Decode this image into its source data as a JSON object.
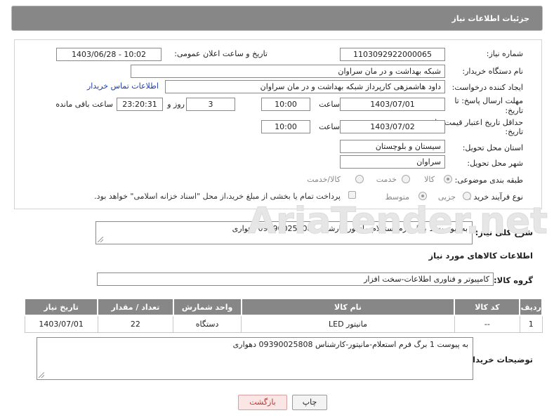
{
  "header": {
    "title": "جزئیات اطلاعات نیاز"
  },
  "form": {
    "need_number_label": "شماره نیاز:",
    "need_number": "1103092922000065",
    "announce_label": "تاریخ و ساعت اعلان عمومی:",
    "announce_value": "1403/06/28 - 10:02",
    "buyer_org_label": "نام دستگاه خریدار:",
    "buyer_org": "شبکه بهداشت و در مان سراوان",
    "creator_label": "ایجاد کننده درخواست:",
    "creator": "داود هاشمزهی  کارپرداز شبکه بهداشت و در مان سراوان",
    "contact_link": "اطلاعات تماس خریدار",
    "reply_deadline_label_1": "مهلت ارسال پاسخ: تا",
    "reply_deadline_label_2": "تاریخ:",
    "reply_date": "1403/07/01",
    "time_label": "ساعت",
    "reply_time": "10:00",
    "days_value": "3",
    "days_label": "روز و",
    "remaining_time": "23:20:31",
    "remaining_label": "ساعت باقی مانده",
    "price_validity_label_1": "حداقل تاریخ اعتبار قیمت: تا",
    "price_validity_label_2": "تاریخ:",
    "validity_date": "1403/07/02",
    "validity_time": "10:00",
    "province_label": "استان محل تحویل:",
    "province": "سیستان و بلوچستان",
    "city_label": "شهر محل تحویل:",
    "city": "سراوان",
    "category_label": "طبقه بندی موضوعی:",
    "category_options": [
      "کالا",
      "خدمت",
      "کالا/خدمت"
    ],
    "purchase_type_label": "نوع فرآیند خرید :",
    "purchase_options": [
      "جزیی",
      "متوسط"
    ],
    "treasury_note": "پرداخت تمام یا بخشی از مبلغ خرید،از محل \"اسناد خزانه اسلامی\" خواهد بود."
  },
  "description": {
    "label": "شرح کلی نیاز:",
    "text": "به پیوست 1 برگ فرم استعلام-مانیتور-کارشناس 09390025808 دهواری"
  },
  "goods": {
    "section_title": "اطلاعات کالاهای مورد نیاز",
    "group_label": "گروه کالا:",
    "group_value": "کامپیوتر و فناوری اطلاعات-سخت افزار",
    "columns": [
      "ردیف",
      "کد کالا",
      "نام کالا",
      "واحد شمارش",
      "تعداد / مقدار",
      "تاریخ نیاز"
    ],
    "rows": [
      [
        "1",
        "--",
        "مانیتور LED",
        "دستگاه",
        "22",
        "1403/07/01"
      ]
    ]
  },
  "buyer_notes": {
    "label": "توضیحات خریدار:",
    "text": "به پیوست 1 برگ فرم استعلام-مانیتور-کارشناس 09390025808 دهواری"
  },
  "buttons": {
    "print": "چاپ",
    "back": "بازگشت"
  },
  "watermark": {
    "text": "AriaTender.net"
  },
  "colors": {
    "header_bg": "#878787",
    "link": "#1c3fa8",
    "back_button_text": "#c03030"
  }
}
